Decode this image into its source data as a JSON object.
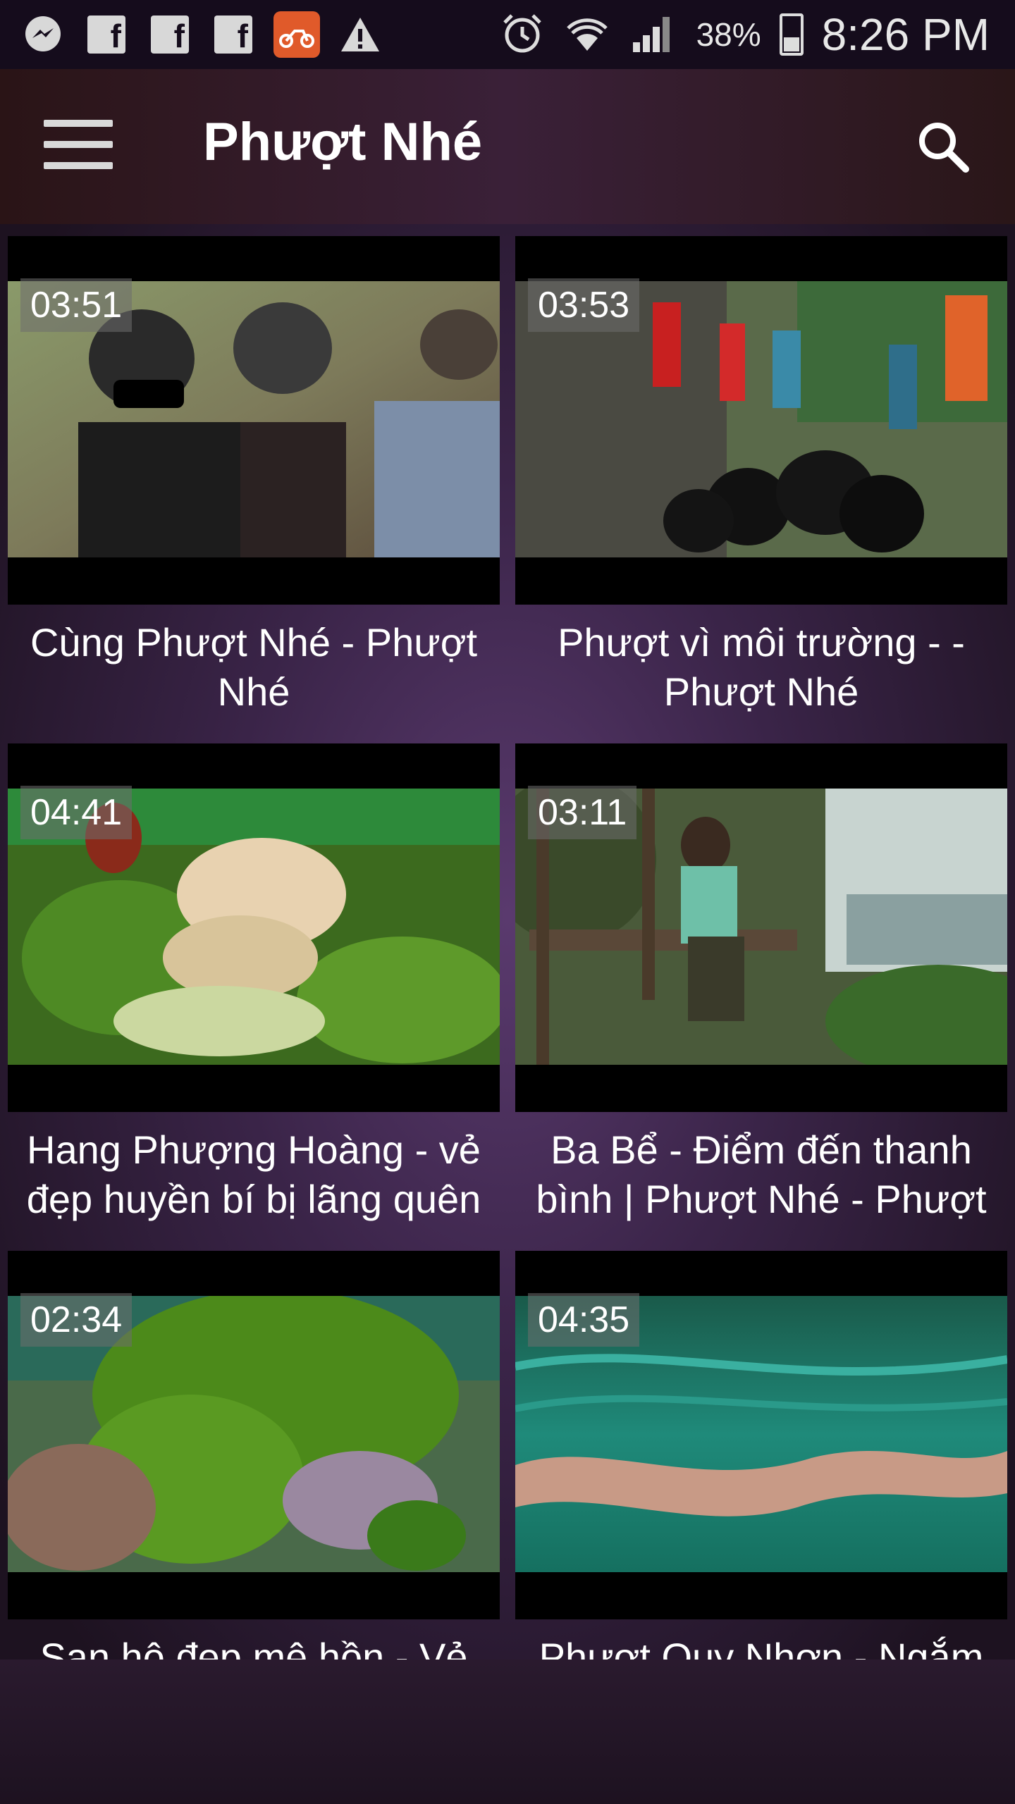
{
  "status_bar": {
    "icons_left": [
      "messenger-icon",
      "facebook-icon",
      "facebook-icon",
      "facebook-icon",
      "moto-app-icon",
      "warning-icon"
    ],
    "icons_right": [
      "alarm-icon",
      "wifi-icon",
      "signal-icon",
      "battery-icon"
    ],
    "battery_percent": "38%",
    "time": "8:26 PM"
  },
  "app_bar": {
    "title": "Phượt Nhé",
    "menu_icon": "hamburger-menu-icon",
    "search_icon": "search-icon"
  },
  "videos": [
    {
      "duration": "03:51",
      "title": "Cùng Phượt Nhé - Phượt Nhé"
    },
    {
      "duration": "03:53",
      "title": "Phượt vì môi trường -  - Phượt Nhé"
    },
    {
      "duration": "04:41",
      "title": "Hang Phượng Hoàng - vẻ đẹp huyền bí bị lãng quên"
    },
    {
      "duration": "03:11",
      "title": "Ba Bể - Điểm đến thanh bình | Phượt Nhé - Phượt"
    },
    {
      "duration": "02:34",
      "title": "San hô đẹp mê hồn - Vẻ"
    },
    {
      "duration": "04:35",
      "title": "Phượt Quy Nhơn - Ngắm"
    }
  ],
  "colors": {
    "status_bar_bg": "#150c1c",
    "accent_app_icon": "#e05a2a"
  }
}
